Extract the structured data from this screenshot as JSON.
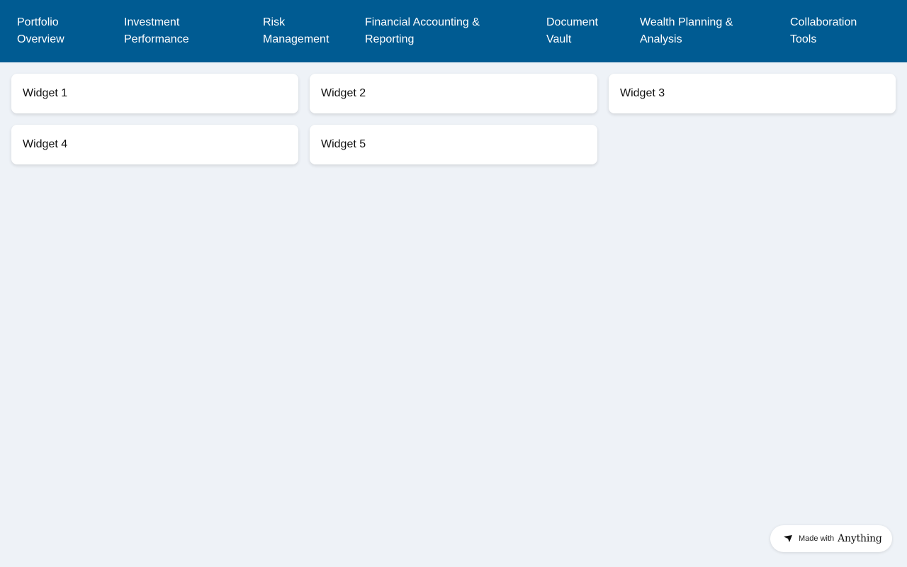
{
  "nav": {
    "items": [
      {
        "label": "Portfolio Overview"
      },
      {
        "label": "Investment Performance"
      },
      {
        "label": "Risk Management"
      },
      {
        "label": "Financial Accounting & Reporting"
      },
      {
        "label": "Document Vault"
      },
      {
        "label": "Wealth Planning & Analysis"
      },
      {
        "label": "Collaboration Tools"
      }
    ]
  },
  "widgets": [
    {
      "title": "Widget 1"
    },
    {
      "title": "Widget 2"
    },
    {
      "title": "Widget 3"
    },
    {
      "title": "Widget 4"
    },
    {
      "title": "Widget 5"
    }
  ],
  "badge": {
    "prefix": "Made with",
    "brand": "Anything",
    "icon": "anything-logo-icon"
  },
  "colors": {
    "nav_background": "#005b92",
    "page_background": "#eef2f7",
    "card_background": "#ffffff"
  }
}
